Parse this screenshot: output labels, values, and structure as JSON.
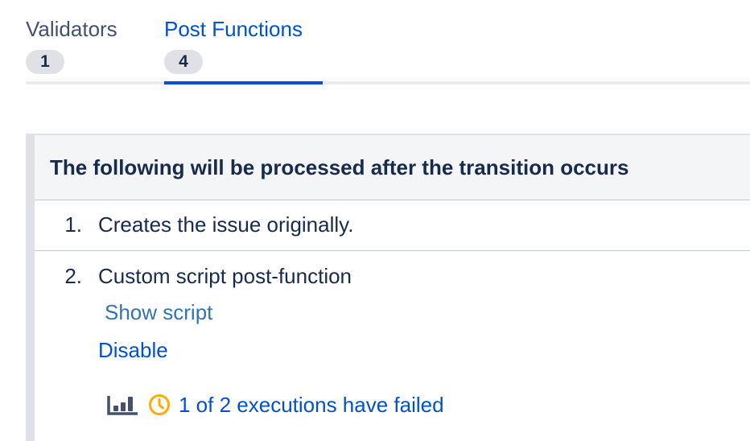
{
  "tabs": [
    {
      "label": "Validators",
      "count": "1",
      "active": false
    },
    {
      "label": "Post Functions",
      "count": "4",
      "active": true
    }
  ],
  "panel": {
    "header": "The following will be processed after the transition occurs",
    "items": [
      {
        "number": "1.",
        "text": "Creates the issue originally."
      },
      {
        "number": "2.",
        "text": "Custom script post-function",
        "show_script_label": "Show script",
        "disable_label": "Disable",
        "executions_text": "1 of 2 executions have failed"
      }
    ]
  },
  "icons": {
    "chart": "bar-chart-icon",
    "clock": "clock-icon"
  },
  "colors": {
    "accent": "#0052cc",
    "link": "#3572b0",
    "warning": "#ffab00",
    "text": "#172b4d",
    "tab_inactive": "#42526e"
  }
}
